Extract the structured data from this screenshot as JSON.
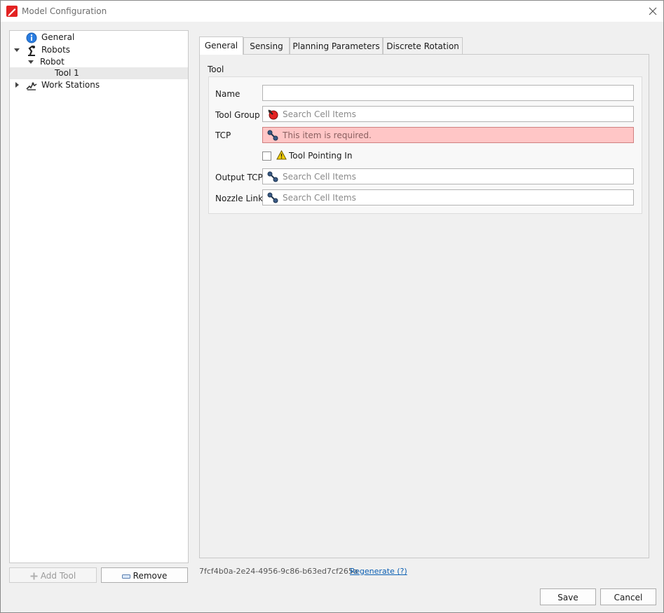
{
  "window": {
    "title": "Model Configuration"
  },
  "tree": {
    "items": [
      {
        "label": "General",
        "level": 1
      },
      {
        "label": "Robots",
        "level": 1
      },
      {
        "label": "Robot",
        "level": 2
      },
      {
        "label": "Tool 1",
        "level": 3
      },
      {
        "label": "Work Stations",
        "level": 1
      }
    ]
  },
  "left_buttons": {
    "add_tool": "Add Tool",
    "remove": "Remove"
  },
  "tabs": [
    "General",
    "Sensing",
    "Planning Parameters",
    "Discrete Rotation"
  ],
  "tool_group": {
    "title": "Tool",
    "name_label": "Name",
    "name_value": "",
    "tool_group_label": "Tool Group",
    "tool_group_placeholder": "Search Cell Items",
    "tcp_label": "TCP",
    "tcp_placeholder": "This item is required.",
    "tool_pointing_in_label": "Tool Pointing In",
    "output_tcp_label": "Output TCP",
    "output_tcp_placeholder": "Search Cell Items",
    "nozzle_link_label": "Nozzle Link",
    "nozzle_link_placeholder": "Search Cell Items"
  },
  "footer": {
    "uuid": "7fcf4b0a-2e24-4956-9c86-b63ed7cf265a",
    "regenerate": "Regenerate (?)",
    "save": "Save",
    "cancel": "Cancel"
  },
  "colors": {
    "error_bg": "#ffc6c6",
    "link": "#0b5fb3",
    "accent_red": "#e32222"
  }
}
